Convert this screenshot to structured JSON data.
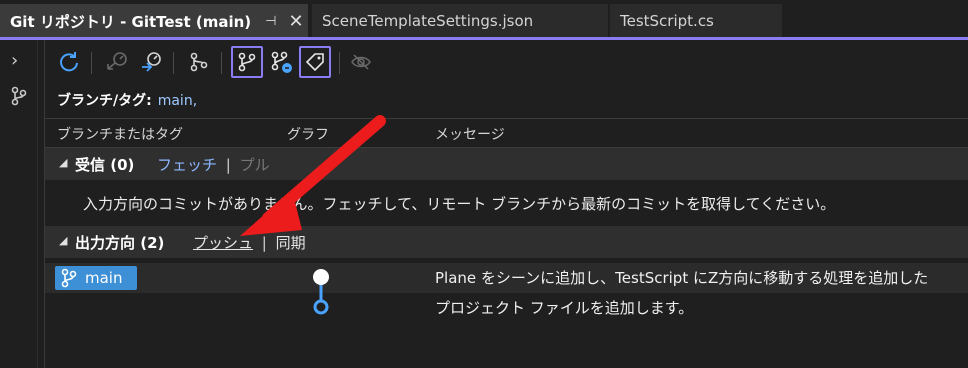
{
  "tabs": [
    {
      "label": "Git リポジトリ - GitTest (main)",
      "pin": "⊣",
      "close": "✕"
    },
    {
      "label": "SceneTemplateSettings.json"
    },
    {
      "label": "TestScript.cs"
    }
  ],
  "accent": "#8a7cf2",
  "toolbar_icons": [
    "refresh-icon",
    "fetch-icon",
    "pull-icon",
    "branch-graph-icon",
    "branch-icon",
    "local-branch-icon",
    "tag-icon",
    "hide-icon"
  ],
  "branch_tag": {
    "label": "ブランチ/タグ:",
    "value": "main,"
  },
  "columns": {
    "c1": "ブランチまたはタグ",
    "c2": "グラフ",
    "c3": "メッセージ"
  },
  "incoming": {
    "title": "受信 (0)",
    "fetch": "フェッチ",
    "separator": "|",
    "pull": "プル",
    "message": "入力方向のコミットがありません。フェッチして、リモート ブランチから最新のコミットを取得してください。"
  },
  "outgoing": {
    "title": "出力方向 (2)",
    "push": "プッシュ",
    "separator": "|",
    "sync": "同期"
  },
  "commit": {
    "branch": "main",
    "message_line1": "Plane をシーンに追加し、TestScript にZ方向に移動する処理を追加した",
    "message_line2": "プロジェクト ファイルを追加します。"
  }
}
